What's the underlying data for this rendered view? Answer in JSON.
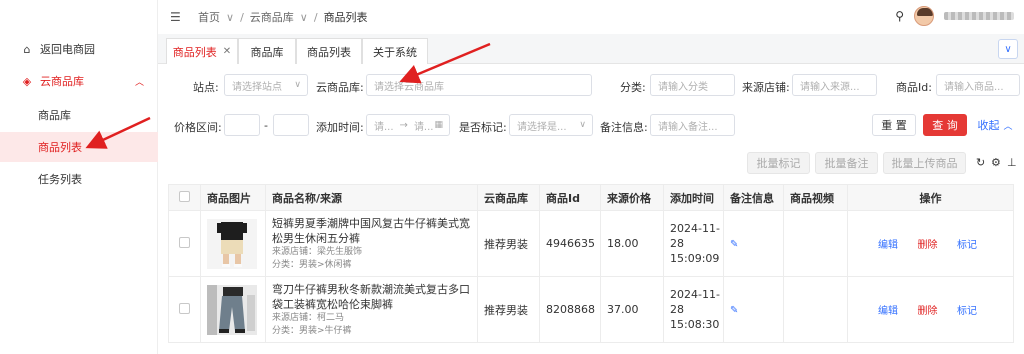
{
  "sidebar": {
    "items": [
      {
        "label": "返回电商园",
        "icon": "home-icon"
      },
      {
        "label": "云商品库",
        "icon": "cube-icon"
      },
      {
        "label": "商品库"
      },
      {
        "label": "商品列表"
      },
      {
        "label": "任务列表"
      }
    ]
  },
  "topbar": {
    "breadcrumb": [
      "首页",
      "云商品库",
      "商品列表"
    ]
  },
  "tabs": [
    {
      "label": "商品列表"
    },
    {
      "label": "商品库"
    },
    {
      "label": "商品列表"
    },
    {
      "label": "关于系统"
    }
  ],
  "filters": {
    "site_label": "站点:",
    "site_placeholder": "请选择站点",
    "cloud_label": "云商品库:",
    "cloud_placeholder": "请选择云商品库",
    "category_label": "分类:",
    "category_placeholder": "请输入分类",
    "shop_label": "来源店铺:",
    "shop_placeholder": "请输入来源...",
    "id_label": "商品Id:",
    "id_placeholder": "请输入商品...",
    "price_label": "价格区间:",
    "price_sep": "-",
    "time_label": "添加时间:",
    "time_start": "请...",
    "time_end": "请...",
    "flag_label": "是否标记:",
    "flag_placeholder": "请选择是...",
    "note_label": "备注信息:",
    "note_placeholder": "请输入备注..."
  },
  "buttons": {
    "reset": "重 置",
    "query": "查 询",
    "collapse": "收起",
    "batch_flag": "批量标记",
    "batch_note": "批量备注",
    "batch_upload": "批量上传商品"
  },
  "table": {
    "headers": [
      "商品图片",
      "商品名称/来源",
      "云商品库",
      "商品Id",
      "来源价格",
      "添加时间",
      "备注信息",
      "商品视频",
      "操作"
    ],
    "rows": [
      {
        "title": "短裤男夏季潮牌中国风复古牛仔裤美式宽松男生休闲五分裤",
        "shop": "来源店铺：梁先生服饰",
        "category": "分类：男装>休闲裤",
        "library": "推荐男装",
        "id": "4946635",
        "price": "18.00",
        "time": "2024-11-28 15:09:09",
        "actions": [
          "编辑",
          "删除",
          "标记"
        ]
      },
      {
        "title": "弯刀牛仔裤男秋冬新款潮流美式复古多口袋工装裤宽松哈伦束脚裤",
        "shop": "来源店铺：柯二马",
        "category": "分类：男装>牛仔裤",
        "library": "推荐男装",
        "id": "8208868",
        "price": "37.00",
        "time": "2024-11-28 15:08:30",
        "actions": [
          "编辑",
          "删除",
          "标记"
        ]
      }
    ]
  }
}
